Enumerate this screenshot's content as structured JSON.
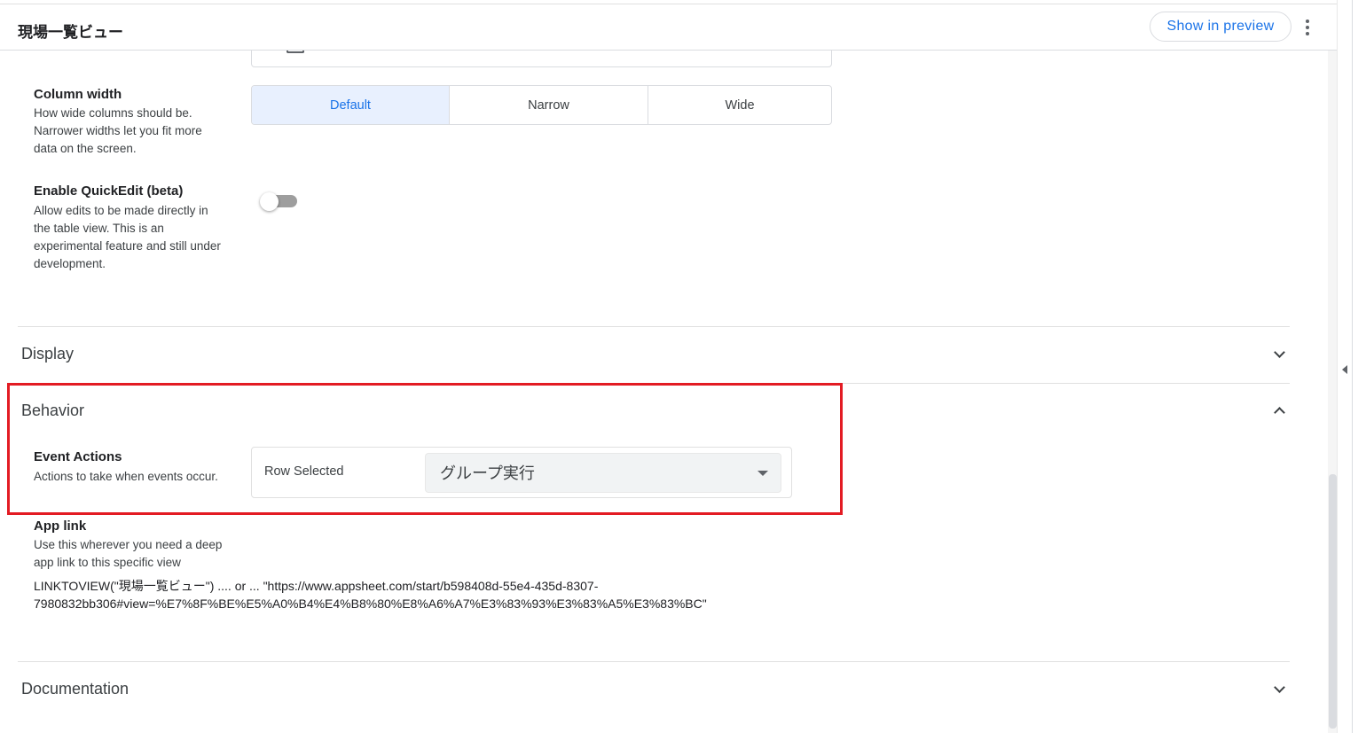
{
  "header": {
    "title": "現場一覧ビュー",
    "show_in_preview": "Show in preview"
  },
  "column_width": {
    "label": "Column width",
    "description_lines": [
      "How wide columns should be.",
      "Narrower widths let you fit more",
      "data on the screen."
    ],
    "options": [
      "Default",
      "Narrow",
      "Wide"
    ],
    "selected": "Default"
  },
  "quickedit": {
    "label": "Enable QuickEdit (beta)",
    "description_lines": [
      "Allow edits to be made directly in",
      "the table view. This is an",
      "experimental feature and still under",
      "development."
    ],
    "enabled": false
  },
  "sections": {
    "display": "Display",
    "behavior": "Behavior",
    "documentation": "Documentation"
  },
  "event_actions": {
    "label": "Event Actions",
    "description": "Actions to take when events occur.",
    "row_label": "Row Selected",
    "selected_value": "グループ実行"
  },
  "app_link": {
    "label": "App link",
    "description_lines": [
      "Use this wherever you need a deep",
      "app link to this specific view"
    ],
    "line1": "LINKTOVIEW(\"現場一覧ビュー\") .... or ... \"https://www.appsheet.com/start/b598408d-55e4-435d-8307-",
    "line2": "7980832bb306#view=%E7%8F%BE%E5%A0%B4%E4%B8%80%E8%A6%A7%E3%83%93%E3%83%A5%E3%83%BC\""
  },
  "colors": {
    "accent": "#1a73e8",
    "highlight": "#e31b23"
  }
}
